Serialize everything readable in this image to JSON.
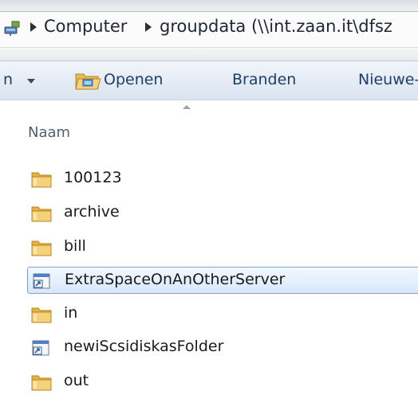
{
  "address": {
    "crumbs": [
      {
        "label": "Computer"
      },
      {
        "label": "groupdata (\\\\int.zaan.it\\dfsz"
      }
    ]
  },
  "toolbar": {
    "organize_label": "n",
    "open_label": "Openen",
    "burn_label": "Branden",
    "new_label": "Nieuwe-"
  },
  "list": {
    "column_name": "Naam",
    "items": [
      {
        "label": "100123",
        "icon": "folder-icon"
      },
      {
        "label": "archive",
        "icon": "folder-icon"
      },
      {
        "label": "bill",
        "icon": "folder-icon"
      },
      {
        "label": "ExtraSpaceOnAnOtherServer",
        "icon": "shortcut-icon",
        "selected": true
      },
      {
        "label": "in",
        "icon": "folder-icon"
      },
      {
        "label": "newiScsidiskasFolder",
        "icon": "shortcut-icon"
      },
      {
        "label": "out",
        "icon": "folder-icon"
      }
    ]
  },
  "colors": {
    "selection_border": "#7da2ce",
    "selection_fill": "#d7e8fb",
    "folder": "#e8b73c",
    "toolbar_text": "#1e3f66"
  }
}
